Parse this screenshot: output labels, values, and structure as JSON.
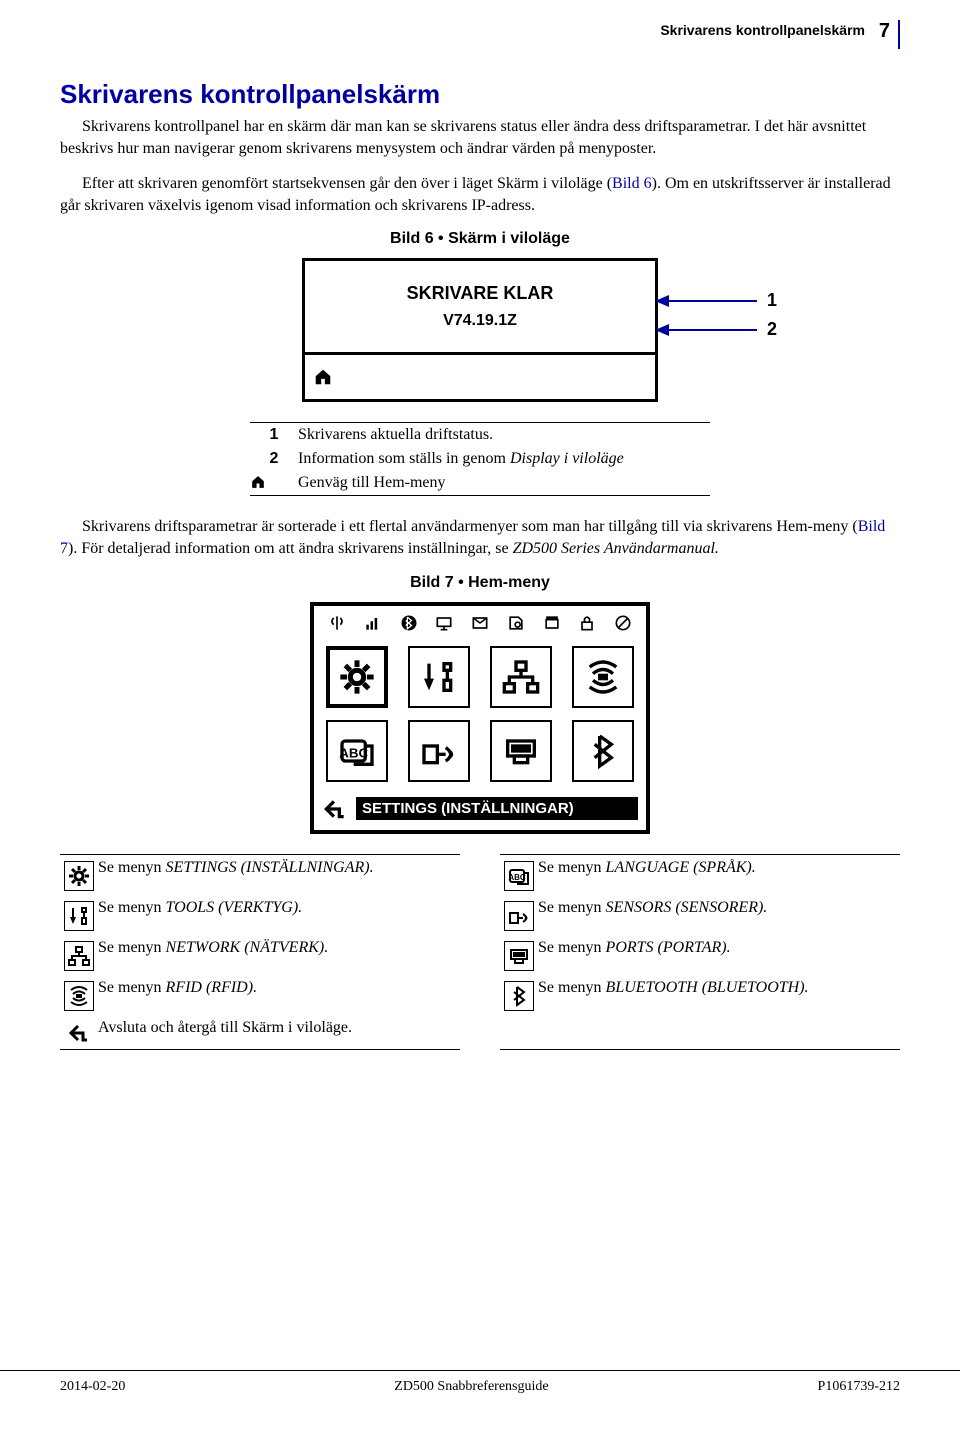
{
  "header": {
    "running_title": "Skrivarens kontrollpanelskärm",
    "page_number": "7"
  },
  "section_title": "Skrivarens kontrollpanelskärm",
  "para1": "Skrivarens kontrollpanel har en skärm där man kan se skrivarens status eller ändra dess driftsparametrar. I det här avsnittet beskrivs hur man navigerar genom skrivarens menysystem och ändrar värden på menyposter.",
  "para2a": "Efter att skrivaren genomfört startsekvensen går den över i läget Skärm i viloläge (",
  "para2_link": "Bild 6",
  "para2b": "). Om en utskriftsserver är installerad går skrivaren växelvis igenom visad information och skrivarens IP-adress.",
  "fig6_caption": "Bild 6 • Skärm i viloläge",
  "lcd_status": "SKRIVARE KLAR",
  "lcd_version": "V74.19.1Z",
  "arrow1": "1",
  "arrow2": "2",
  "legend6": {
    "r1_key": "1",
    "r1_val": "Skrivarens aktuella driftstatus.",
    "r2_key": "2",
    "r2_val_a": "Information som ställs in genom  ",
    "r2_val_i": "Display i viloläge",
    "r3_val": "Genväg till Hem-meny"
  },
  "para3a": "Skrivarens driftsparametrar är sorterade i ett flertal användarmenyer som man har tillgång till via skrivarens Hem-meny (",
  "para3_link": "Bild 7",
  "para3b": "). För detaljerad information om att ändra skrivarens inställningar, se ",
  "para3_i": "ZD500 Series Användarmanual.",
  "fig7_caption": "Bild 7 • Hem-meny",
  "fig7_bar": "SETTINGS (INSTÄLLNINGAR)",
  "menus_left": [
    {
      "pre": "Se menyn ",
      "italic": "SETTINGS (INSTÄLLNINGAR)."
    },
    {
      "pre": "Se menyn ",
      "italic": "TOOLS (VERKTYG)."
    },
    {
      "pre": "Se menyn ",
      "italic": "NETWORK (NÄTVERK)."
    },
    {
      "pre": "Se menyn ",
      "italic": "RFID (RFID)."
    },
    {
      "pre": "",
      "italic": "",
      "plain": "Avsluta och återgå till Skärm i viloläge."
    }
  ],
  "menus_right": [
    {
      "pre": "Se menyn ",
      "italic": "LANGUAGE (SPRÅK)."
    },
    {
      "pre": "Se menyn ",
      "italic": "SENSORS (SENSORER)."
    },
    {
      "pre": "Se menyn ",
      "italic": "PORTS (PORTAR)."
    },
    {
      "pre": "Se menyn ",
      "italic": "BLUETOOTH (BLUETOOTH)."
    }
  ],
  "footer": {
    "left": "2014-02-20",
    "center": "ZD500 Snabbreferensguide",
    "right": "P1061739-212"
  }
}
